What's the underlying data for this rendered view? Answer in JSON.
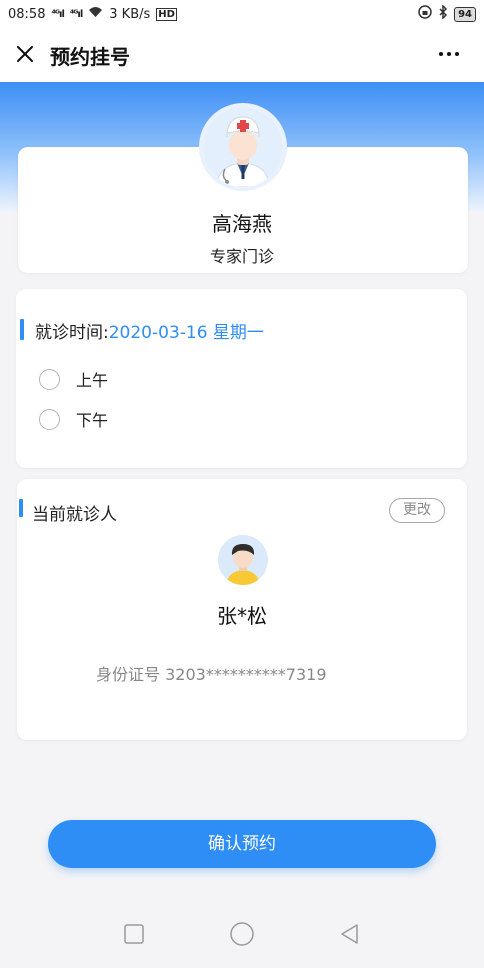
{
  "status_bar": {
    "time": "08:58",
    "signal1": "⁴ᴳıl",
    "signal2": "⁴ᴳıl",
    "speed": "3 KB/s",
    "hd": "HD",
    "battery": "94"
  },
  "header": {
    "title": "预约挂号"
  },
  "doctor": {
    "name": "高海燕",
    "type": "专家门诊"
  },
  "schedule": {
    "label": "就诊时间:",
    "value": "2020-03-16 星期一",
    "options": [
      {
        "label": "上午"
      },
      {
        "label": "下午"
      }
    ]
  },
  "patient": {
    "section_title": "当前就诊人",
    "change_label": "更改",
    "name": "张*松",
    "id_label": "身份证号 3203**********7319"
  },
  "actions": {
    "confirm_label": "确认预约"
  },
  "colors": {
    "accent": "#2f8ef5",
    "banner_top": "#3d8ff5"
  },
  "icons": {
    "close": "close-icon",
    "more": "more-icon",
    "nav_recent": "square-icon",
    "nav_home": "circle-icon",
    "nav_back": "triangle-back-icon"
  }
}
